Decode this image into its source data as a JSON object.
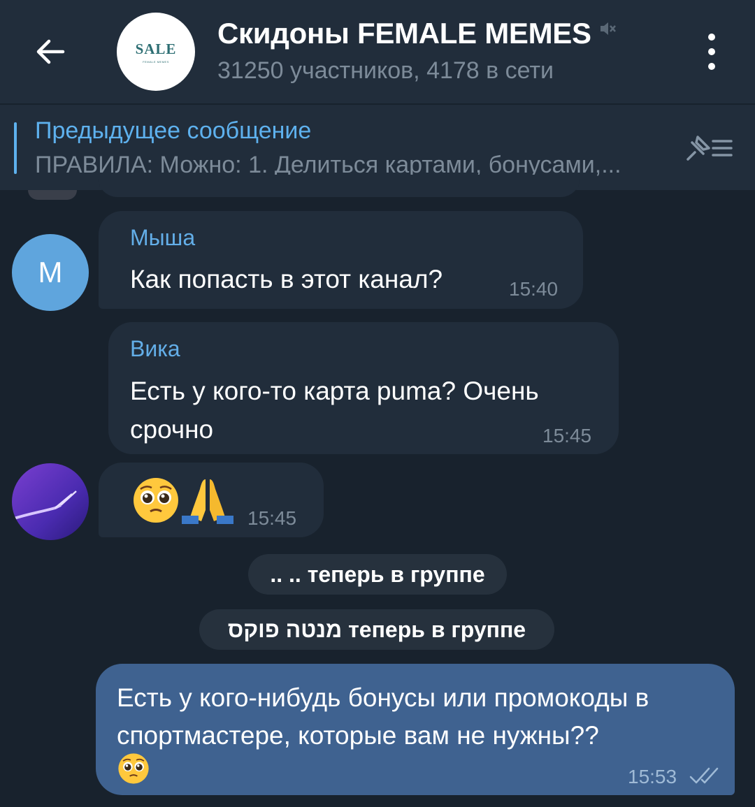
{
  "header": {
    "back_icon": "arrow-left-icon",
    "avatar_text": "SALE",
    "avatar_subtext": "FEMALE MEMES",
    "title": "Скидоны FEMALE MEMES",
    "muted_icon": "mute-icon",
    "subtitle": "31250 участников, 4178 в сети",
    "menu_icon": "more-vertical-icon"
  },
  "pinned": {
    "title": "Предыдущее сообщение",
    "text": "ПРАВИЛА:  Можно: 1. Делиться картами, бонусами,...",
    "icon": "pinned-list-icon"
  },
  "messages": [
    {
      "sender": "Мыша",
      "avatar_letter": "M",
      "text": "Как попасть в этот канал?",
      "time": "15:40"
    },
    {
      "sender": "Вика",
      "text": "Есть у кого-то карта puma? Очень срочно",
      "time": "15:45"
    },
    {
      "emoji": "pleading-face 🙏",
      "time": "15:45"
    }
  ],
  "service_messages": [
    ".. .. теперь в группе",
    "מנטה פוקס теперь в группе"
  ],
  "outgoing": {
    "text": "Есть у кого-нибудь бонусы или промокоды в спортмастере, которые вам не нужны??",
    "emoji": "pleading-face",
    "time": "15:53",
    "status_icon": "double-check-icon"
  },
  "colors": {
    "background": "#18222d",
    "header": "#212d3b",
    "accent": "#5eb1ee",
    "incoming_bubble": "#212d3b",
    "outgoing_bubble": "#3f6290"
  }
}
